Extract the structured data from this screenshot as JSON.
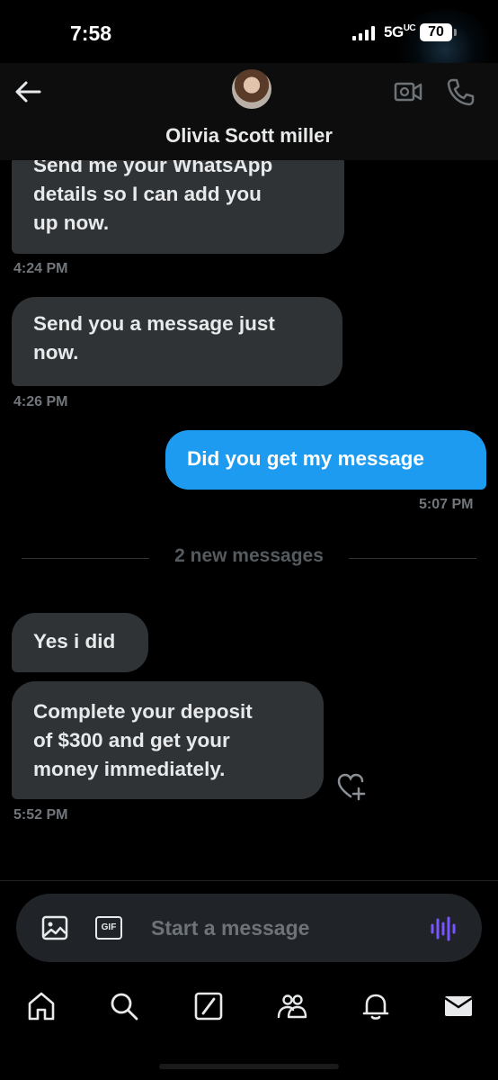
{
  "status_bar": {
    "time": "7:58",
    "network": "5G",
    "network_suffix": "UC",
    "battery": "70"
  },
  "header": {
    "contact_name": "Olivia Scott miller",
    "back_icon": "arrow-left-icon",
    "video_icon": "video-camera-icon",
    "phone_icon": "phone-icon"
  },
  "messages": [
    {
      "direction": "incoming",
      "text": "Send me your WhatsApp details so I can add you up now.",
      "line1": "Send me your WhatsApp",
      "line2": "details so I can add you",
      "line3": "up now.",
      "time": "4:24 PM"
    },
    {
      "direction": "incoming",
      "text": "Send you a message just now.",
      "line1": "Send you a message just",
      "line2": "now.",
      "time": "4:26 PM"
    },
    {
      "direction": "outgoing",
      "text": "Did you get my message",
      "time": "5:07 PM"
    },
    {
      "direction": "incoming",
      "text": "Yes i did"
    },
    {
      "direction": "incoming",
      "text": "Complete your deposit of $300 and get your money immediately.",
      "line1": "Complete your deposit",
      "line2": "of $300 and get your",
      "line3": "money immediately.",
      "time": "5:52 PM"
    }
  ],
  "divider": {
    "label": "2 new messages"
  },
  "composer": {
    "placeholder": "Start a message",
    "gif_label": "GIF"
  },
  "nav": [
    {
      "name": "home",
      "icon": "home-icon"
    },
    {
      "name": "search",
      "icon": "search-icon"
    },
    {
      "name": "grok",
      "icon": "grok-icon"
    },
    {
      "name": "communities",
      "icon": "communities-icon"
    },
    {
      "name": "notifications",
      "icon": "bell-icon"
    },
    {
      "name": "messages",
      "icon": "mail-icon",
      "active": true
    }
  ],
  "colors": {
    "background": "#000000",
    "incoming_bubble": "#2f3336",
    "outgoing_bubble": "#1d9bf0",
    "muted_text": "#71767b",
    "voice_accent": "#7856ff"
  }
}
